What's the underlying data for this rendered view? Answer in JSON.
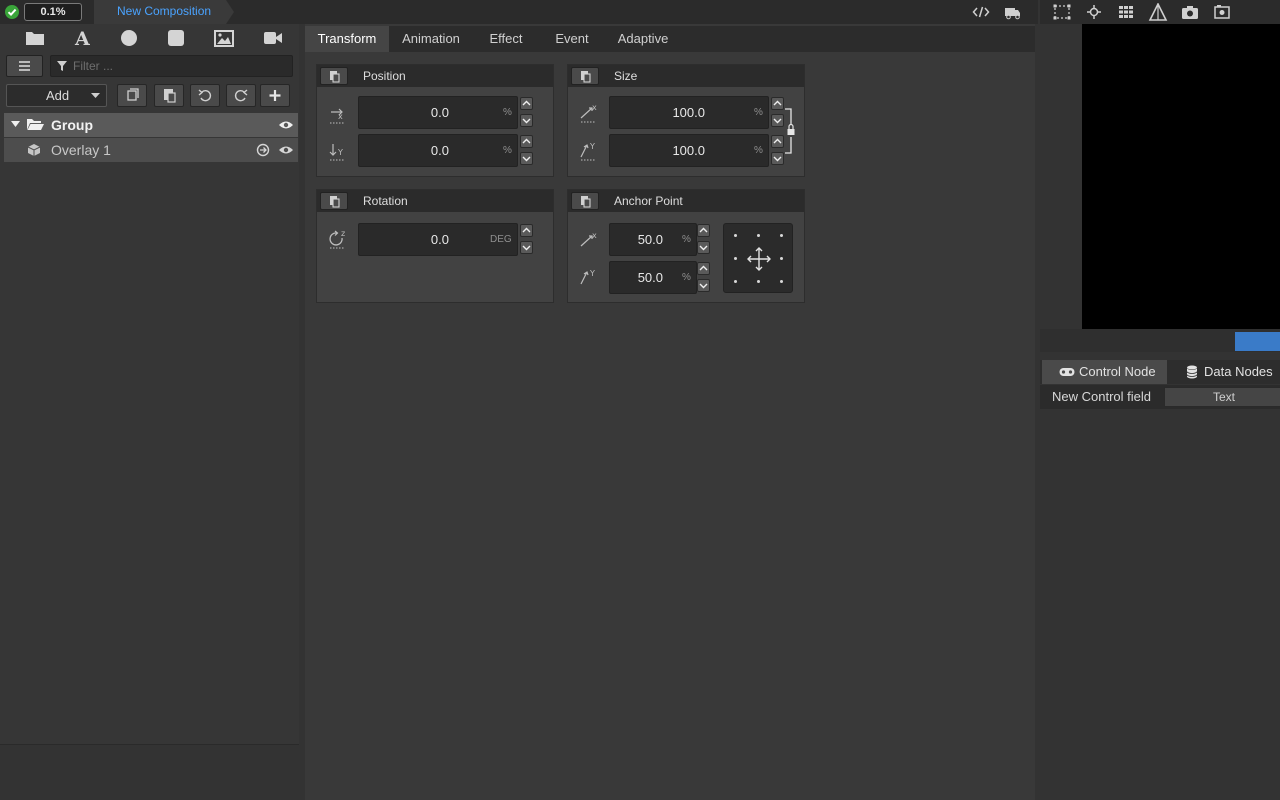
{
  "topbar": {
    "progress": "0.1%",
    "composition_tab": "New Composition"
  },
  "left": {
    "filter_placeholder": "Filter ...",
    "add_label": "Add",
    "tree": [
      {
        "label": "Group"
      },
      {
        "label": "Overlay 1"
      }
    ]
  },
  "center": {
    "tabs": [
      "Transform",
      "Animation",
      "Effect",
      "Event",
      "Adaptive"
    ],
    "position": {
      "title": "Position",
      "x": "0.0",
      "x_unit": "%",
      "y": "0.0",
      "y_unit": "%"
    },
    "size": {
      "title": "Size",
      "x": "100.0",
      "x_unit": "%",
      "y": "100.0",
      "y_unit": "%"
    },
    "rotation": {
      "title": "Rotation",
      "z": "0.0",
      "z_unit": "DEG"
    },
    "anchor": {
      "title": "Anchor Point",
      "x": "50.0",
      "x_unit": "%",
      "y": "50.0",
      "y_unit": "%"
    }
  },
  "right": {
    "tabs": [
      "Control Node",
      "Data Nodes"
    ],
    "control_field_label": "New Control field",
    "control_field_type": "Text"
  },
  "colors": {
    "accent_blue": "#4aa3ff",
    "status_green": "#3aa53a",
    "preview_bar": "#3a7bc8"
  }
}
